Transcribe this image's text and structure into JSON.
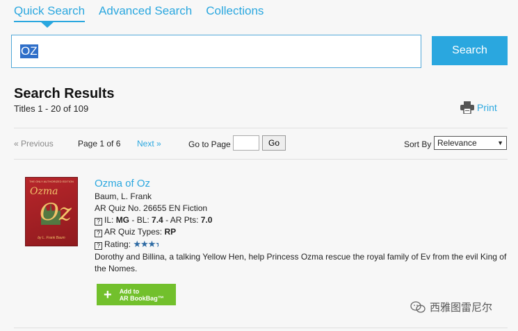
{
  "tabs": [
    {
      "label": "Quick Search",
      "active": true
    },
    {
      "label": "Advanced Search",
      "active": false
    },
    {
      "label": "Collections",
      "active": false
    }
  ],
  "search": {
    "value": "OZ",
    "button_label": "Search"
  },
  "results": {
    "title": "Search Results",
    "count_text": "Titles 1 - 20 of 109",
    "print_label": "Print"
  },
  "pager": {
    "prev_label": "« Previous",
    "page_info": "Page 1 of 6",
    "next_label": "Next »",
    "goto_label": "Go to Page",
    "go_button": "Go",
    "sort_label": "Sort By",
    "sort_value": "Relevance"
  },
  "book": {
    "cover": {
      "edition": "THE ONLY AUTHORIZED EDITION",
      "title_top": "Ozma",
      "title_bottom": "Oz",
      "byline": "by L. Frank Baum"
    },
    "title": "Ozma of Oz",
    "author": "Baum, L. Frank",
    "quiz_line": "AR Quiz No. 26655 EN Fiction",
    "il_prefix": "IL: ",
    "il_value": "MG",
    "bl_prefix": " - BL: ",
    "bl_value": "7.4",
    "pts_prefix": " - AR Pts: ",
    "pts_value": "7.0",
    "quiz_types_label": "AR Quiz Types: ",
    "quiz_types_value": "RP",
    "rating_label": "Rating: ",
    "rating_stars": "★★★",
    "rating_value": 3.5,
    "description": "Dorothy and Billina, a talking Yellow Hen, help Princess Ozma rescue the royal family of Ev from the evil King of the Nomes.",
    "bookbag_line1": "Add to",
    "bookbag_line2": "AR BookBag™"
  },
  "watermark": {
    "text": "西雅图雷尼尔"
  },
  "colors": {
    "accent": "#2aa7df",
    "bookbag_green": "#72c02c",
    "star_blue": "#2d6aa3"
  },
  "icons": {
    "print": "printer-icon",
    "help": "question-box-icon",
    "bookbag": "plus-icon",
    "watermark": "wechat-icon"
  }
}
